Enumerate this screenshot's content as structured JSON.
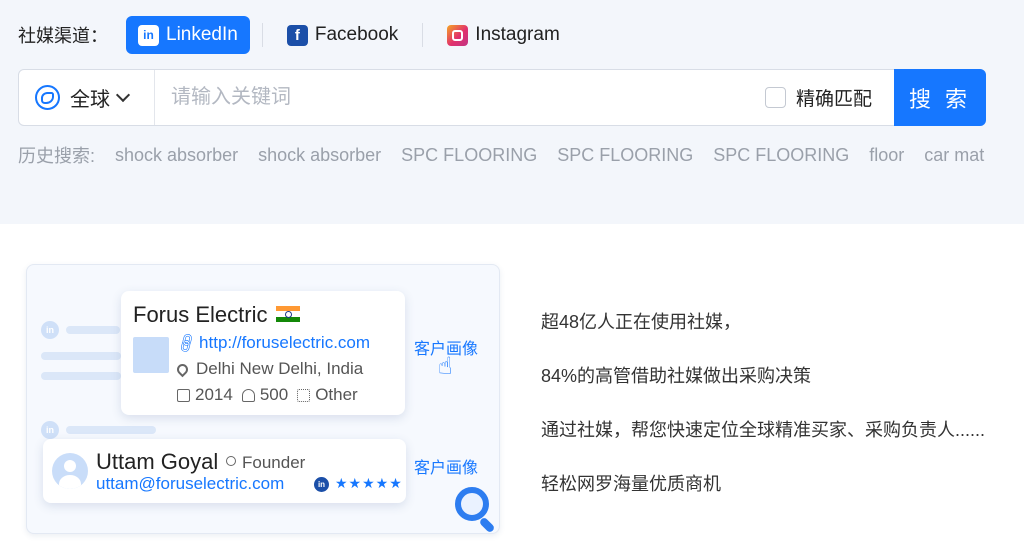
{
  "channels": {
    "label": "社媒渠道：",
    "items": [
      {
        "name": "LinkedIn",
        "icon": "linkedin-icon",
        "glyph": "in",
        "active": true
      },
      {
        "name": "Facebook",
        "icon": "facebook-icon",
        "glyph": "f",
        "active": false
      },
      {
        "name": "Instagram",
        "icon": "instagram-icon",
        "glyph": "",
        "active": false
      }
    ]
  },
  "search": {
    "region": "全球",
    "placeholder": "请输入关键词",
    "value": "",
    "exact_match_label": "精确匹配",
    "exact_match_checked": false,
    "button_label": "搜 索"
  },
  "history": {
    "label": "历史搜索:",
    "items": [
      "shock absorber",
      "shock absorber",
      "SPC FLOORING",
      "SPC FLOORING",
      "SPC FLOORING",
      "floor",
      "car mat"
    ]
  },
  "illustration": {
    "company": {
      "name": "Forus Electric",
      "flag": "india-flag",
      "website": "http://foruselectric.com",
      "location": "Delhi New Delhi, India",
      "year": "2014",
      "employees": "500",
      "category": "Other"
    },
    "profile_link": "客户画像",
    "person": {
      "name": "Uttam Goyal",
      "role": "Founder",
      "email": "uttam@foruselectric.com",
      "badge": "in",
      "rating": "★★★★★"
    },
    "bg_icon": "in"
  },
  "copy": [
    "超48亿人正在使用社媒，",
    "84%的高管借助社媒做出采购决策",
    "通过社媒，帮您快速定位全球精准买家、采购负责人......",
    "轻松网罗海量优质商机"
  ],
  "colors": {
    "accent": "#1677ff",
    "page_bg": "#f3f6fb",
    "muted_text": "#9aa0aa"
  }
}
